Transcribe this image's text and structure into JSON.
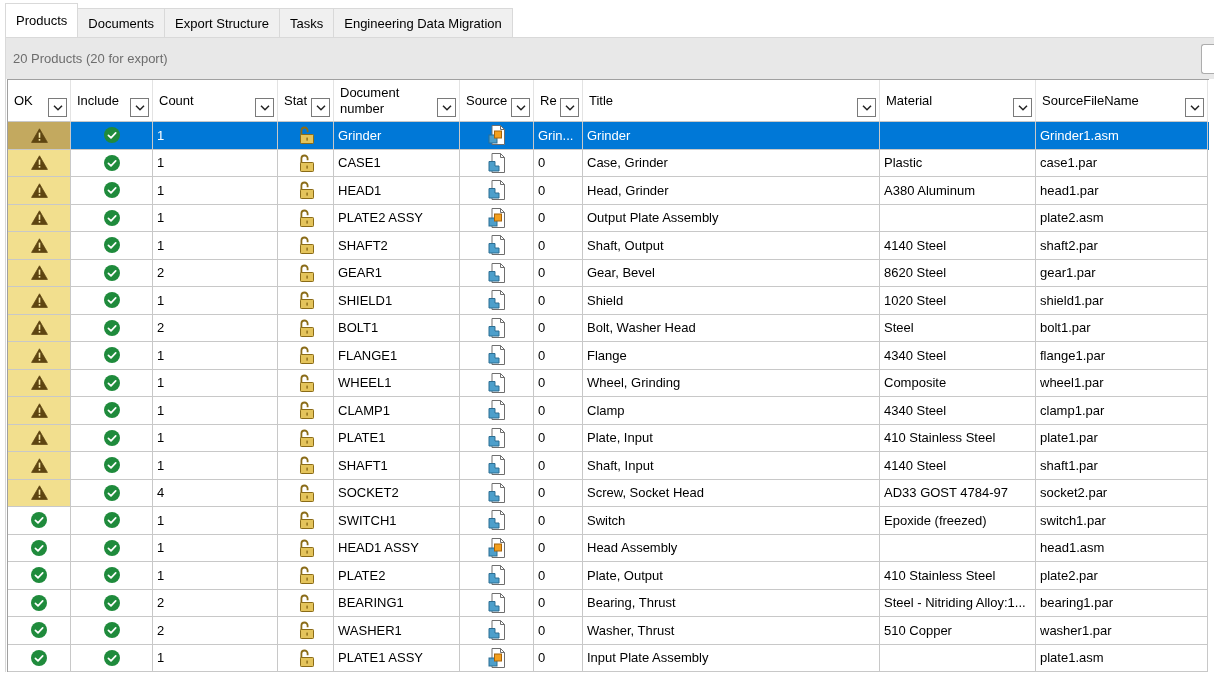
{
  "tabs": [
    {
      "label": "Products",
      "selected": true
    },
    {
      "label": "Documents",
      "selected": false
    },
    {
      "label": "Export Structure",
      "selected": false
    },
    {
      "label": "Tasks",
      "selected": false
    },
    {
      "label": "Engineering Data Migration",
      "selected": false
    }
  ],
  "toolbar": {
    "summary": "20 Products (20 for export)"
  },
  "table": {
    "columns": [
      "OK",
      "Include",
      "Count",
      "Stat",
      "Document number",
      "Source",
      "Re",
      "Title",
      "Material",
      "SourceFileName"
    ],
    "rows": [
      {
        "selected": true,
        "warning": true,
        "included": true,
        "count": "1",
        "locked": false,
        "document_number": "Grinder",
        "assembly": true,
        "column_7": "Grin...",
        "title": "Grinder",
        "source_file_name": "Grinder1.asm"
      },
      {
        "selected": false,
        "warning": true,
        "included": true,
        "count": "1",
        "locked": false,
        "document_number": "CASE1",
        "assembly": false,
        "column_7": "0",
        "title": "Case, Grinder",
        "material": "Plastic",
        "source_file_name": "case1.par"
      },
      {
        "selected": false,
        "warning": true,
        "included": true,
        "count": "1",
        "locked": false,
        "document_number": "HEAD1",
        "assembly": false,
        "column_7": "0",
        "title": "Head, Grinder",
        "material": "A380 Aluminum",
        "source_file_name": "head1.par"
      },
      {
        "selected": false,
        "warning": true,
        "included": true,
        "count": "1",
        "locked": false,
        "document_number": "PLATE2 ASSY",
        "assembly": true,
        "column_7": "0",
        "title": "Output Plate Assembly",
        "source_file_name": "plate2.asm"
      },
      {
        "selected": false,
        "warning": true,
        "included": true,
        "count": "1",
        "locked": false,
        "document_number": "SHAFT2",
        "assembly": false,
        "column_7": "0",
        "title": "Shaft, Output",
        "material": "4140 Steel",
        "source_file_name": "shaft2.par"
      },
      {
        "selected": false,
        "warning": true,
        "included": true,
        "count": "2",
        "locked": false,
        "document_number": "GEAR1",
        "assembly": false,
        "column_7": "0",
        "title": "Gear, Bevel",
        "material": "8620 Steel",
        "source_file_name": "gear1.par"
      },
      {
        "selected": false,
        "warning": true,
        "included": true,
        "count": "1",
        "locked": false,
        "document_number": "SHIELD1",
        "assembly": false,
        "column_7": "0",
        "title": "Shield",
        "material": "1020 Steel",
        "source_file_name": "shield1.par"
      },
      {
        "selected": false,
        "warning": true,
        "included": true,
        "count": "2",
        "locked": false,
        "document_number": "BOLT1",
        "assembly": false,
        "column_7": "0",
        "title": "Bolt, Washer Head",
        "material": "Steel",
        "source_file_name": "bolt1.par"
      },
      {
        "selected": false,
        "warning": true,
        "included": true,
        "count": "1",
        "locked": false,
        "document_number": "FLANGE1",
        "assembly": false,
        "column_7": "0",
        "title": "Flange",
        "material": "4340 Steel",
        "source_file_name": "flange1.par"
      },
      {
        "selected": false,
        "warning": true,
        "included": true,
        "count": "1",
        "locked": false,
        "document_number": "WHEEL1",
        "assembly": false,
        "column_7": "0",
        "title": "Wheel, Grinding",
        "material": "Composite",
        "source_file_name": "wheel1.par"
      },
      {
        "selected": false,
        "warning": true,
        "included": true,
        "count": "1",
        "locked": false,
        "document_number": "CLAMP1",
        "assembly": false,
        "column_7": "0",
        "title": "Clamp",
        "material": "4340 Steel",
        "source_file_name": "clamp1.par"
      },
      {
        "selected": false,
        "warning": true,
        "included": true,
        "count": "1",
        "locked": false,
        "document_number": "PLATE1",
        "assembly": false,
        "column_7": "0",
        "title": "Plate, Input",
        "material": "410 Stainless Steel",
        "source_file_name": "plate1.par"
      },
      {
        "selected": false,
        "warning": true,
        "included": true,
        "count": "1",
        "locked": false,
        "document_number": "SHAFT1",
        "assembly": false,
        "column_7": "0",
        "title": "Shaft, Input",
        "material": "4140 Steel",
        "source_file_name": "shaft1.par"
      },
      {
        "selected": false,
        "warning": true,
        "included": true,
        "count": "4",
        "locked": false,
        "document_number": "SOCKET2",
        "assembly": false,
        "column_7": "0",
        "title": "Screw, Socket Head",
        "material": "AD33 GOST 4784-97",
        "source_file_name": "socket2.par"
      },
      {
        "selected": false,
        "warning": false,
        "included": true,
        "count": "1",
        "locked": false,
        "document_number": "SWITCH1",
        "assembly": false,
        "column_7": "0",
        "title": "Switch",
        "material": "Epoxide (freezed)",
        "source_file_name": "switch1.par"
      },
      {
        "selected": false,
        "warning": false,
        "included": true,
        "count": "1",
        "locked": false,
        "document_number": "HEAD1 ASSY",
        "assembly": true,
        "column_7": "0",
        "title": "Head Assembly",
        "source_file_name": "head1.asm"
      },
      {
        "selected": false,
        "warning": false,
        "included": true,
        "count": "1",
        "locked": false,
        "document_number": "PLATE2",
        "assembly": false,
        "column_7": "0",
        "title": "Plate, Output",
        "material": "410 Stainless Steel",
        "source_file_name": "plate2.par"
      },
      {
        "selected": false,
        "warning": false,
        "included": true,
        "count": "2",
        "locked": false,
        "document_number": "BEARING1",
        "assembly": false,
        "column_7": "0",
        "title": "Bearing, Thrust",
        "material": "Steel - Nitriding Alloy:1...",
        "source_file_name": "bearing1.par"
      },
      {
        "selected": false,
        "warning": false,
        "included": true,
        "count": "2",
        "locked": false,
        "document_number": "WASHER1",
        "assembly": false,
        "column_7": "0",
        "title": "Washer, Thrust",
        "material": "510 Copper",
        "source_file_name": "washer1.par"
      },
      {
        "selected": false,
        "warning": false,
        "included": true,
        "count": "1",
        "locked": false,
        "document_number": "PLATE1 ASSY",
        "assembly": true,
        "column_7": "0",
        "title": "Input Plate Assembly",
        "source_file_name": "plate1.asm"
      }
    ]
  }
}
